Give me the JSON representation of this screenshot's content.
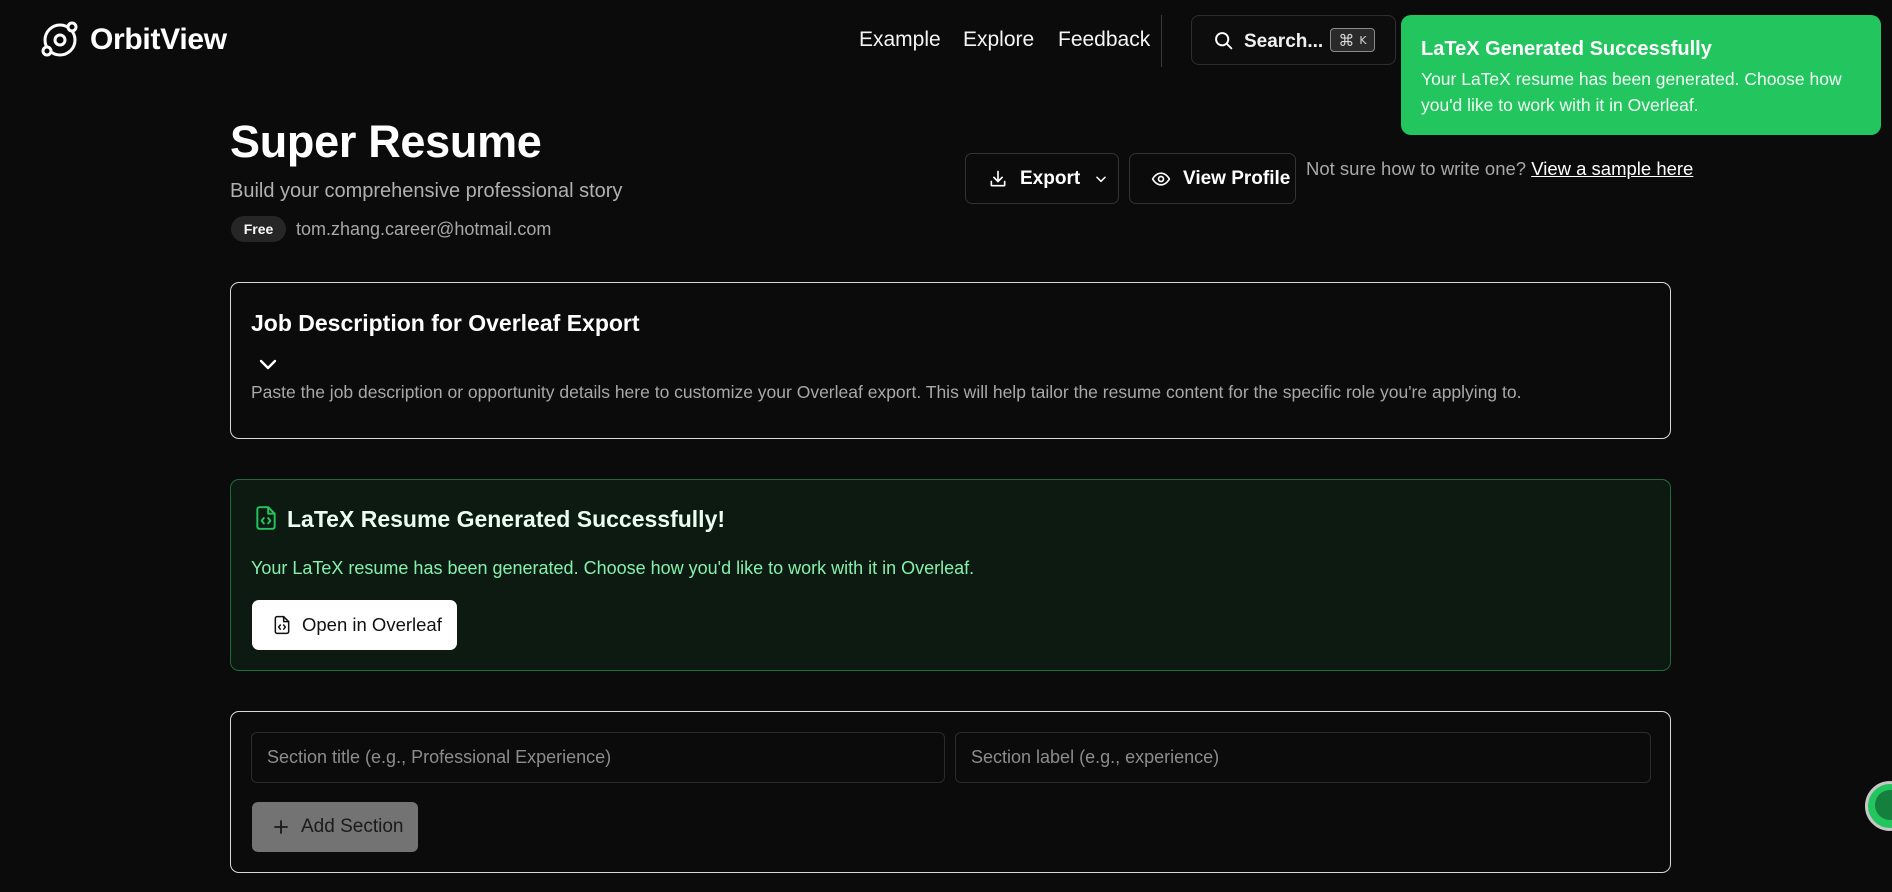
{
  "brand": {
    "name": "OrbitView"
  },
  "nav": {
    "items": [
      {
        "label": "Example"
      },
      {
        "label": "Explore"
      },
      {
        "label": "Feedback"
      }
    ]
  },
  "search": {
    "label": "Search...",
    "shortcut_symbol": "⌘",
    "shortcut_key": "K"
  },
  "toast": {
    "title": "LaTeX Generated Successfully",
    "body": "Your LaTeX resume has been generated. Choose how you'd like to work with it in Overleaf.",
    "color": "#22c55e"
  },
  "page": {
    "title": "Super Resume",
    "subtitle": "Build your comprehensive professional story",
    "plan_badge": "Free",
    "email": "tom.zhang.career@hotmail.com"
  },
  "actions": {
    "export_label": "Export",
    "view_profile_label": "View Profile",
    "sample_prefix": "Not sure how to write one?",
    "sample_link": "View a sample here"
  },
  "job_description": {
    "title": "Job Description for Overleaf Export",
    "description": "Paste the job description or opportunity details here to customize your Overleaf export. This will help tailor the resume content for the specific role you're applying to."
  },
  "latex_result": {
    "title": "LaTeX Resume Generated Successfully!",
    "message": "Your LaTeX resume has been generated. Choose how you'd like to work with it in Overleaf.",
    "open_button": "Open in Overleaf",
    "accent": "#22c55e"
  },
  "add_section": {
    "title_placeholder": "Section title (e.g., Professional Experience)",
    "label_placeholder": "Section label (e.g., experience)",
    "button_label": "Add Section"
  }
}
